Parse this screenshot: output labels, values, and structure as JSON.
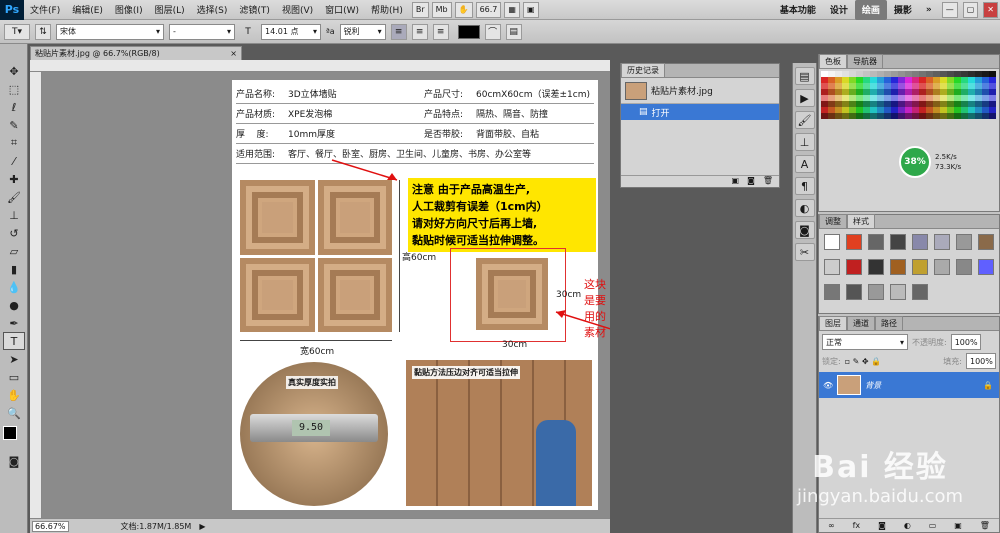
{
  "app": {
    "logo": "Ps"
  },
  "menu": [
    "文件(F)",
    "编辑(E)",
    "图像(I)",
    "图层(L)",
    "选择(S)",
    "滤镜(T)",
    "视图(V)",
    "窗口(W)",
    "帮助(H)"
  ],
  "menubar_buttons": [
    "Br",
    "Mb",
    "66.7"
  ],
  "workspaces": [
    "基本功能",
    "设计",
    "绘画",
    "摄影"
  ],
  "workspace_more": "»",
  "active_workspace": "绘画",
  "options": {
    "font_family": "宋体",
    "font_style": "-",
    "font_size": "14.01 点",
    "aa_label": "ªa",
    "antialias": "锐利"
  },
  "document": {
    "tab_title": "粘贴片素材.jpg @ 66.7%(RGB/8)",
    "tab_close": "×",
    "zoom": "66.67%",
    "doc_info": "文档:1.87M/1.85M"
  },
  "image_content": {
    "spec_rows": [
      [
        "产品名称:",
        "3D立体墙贴",
        "产品尺寸:",
        "60cmX60cm（误差±1cm)"
      ],
      [
        "产品材质:",
        "XPE发泡棉",
        "产品特点:",
        "隔热、隔音、防撞"
      ],
      [
        "厚    度:",
        "10mm厚度",
        "是否带胶:",
        "背面带胶、自粘"
      ]
    ],
    "usage_label": "适用范围:",
    "usage_value": "客厅、餐厅、卧室、厨房、卫生间、儿童房、书房、办公室等",
    "notice_lines": [
      "注意 由于产品高温生产,",
      "人工裁剪有误差（1cm内）",
      "请对好方向尺寸后再上墙,",
      "黏贴时候可适当拉伸调整。"
    ],
    "label_height60": "高60cm",
    "label_width60": "宽60cm",
    "label_30cm_h": "30cm",
    "label_30cm_w": "30cm",
    "annotation": "这块是要用的素材",
    "photo1_caption": "真实厚度实拍",
    "caliper_reading": "9.50",
    "photo2_caption": "黏贴方法压边对齐可适当拉伸"
  },
  "history_panel": {
    "title": "历史记录",
    "snapshot": "粘贴片素材.jpg",
    "step": "打开"
  },
  "color_panel": {
    "tabs": [
      "色板",
      "导航器"
    ]
  },
  "net_widget": {
    "percent": "38%",
    "up": "2.5K/s",
    "down": "73.3K/s"
  },
  "adjust_panel": {
    "tabs": [
      "调整",
      "样式"
    ]
  },
  "layers_panel": {
    "tabs": [
      "图层",
      "通道",
      "路径"
    ],
    "blend_mode": "正常",
    "opacity_label": "不透明度:",
    "opacity": "100%",
    "lock_label": "锁定:",
    "fill_label": "填充:",
    "fill": "100%",
    "layer_name": "背景"
  },
  "watermark": {
    "logo": "Bai  经验",
    "url": "jingyan.baidu.com"
  },
  "colors": {
    "accent": "#3a78d4",
    "notice_bg": "#ffe600",
    "annotation": "#e01010",
    "tile": "#c9a07a"
  }
}
